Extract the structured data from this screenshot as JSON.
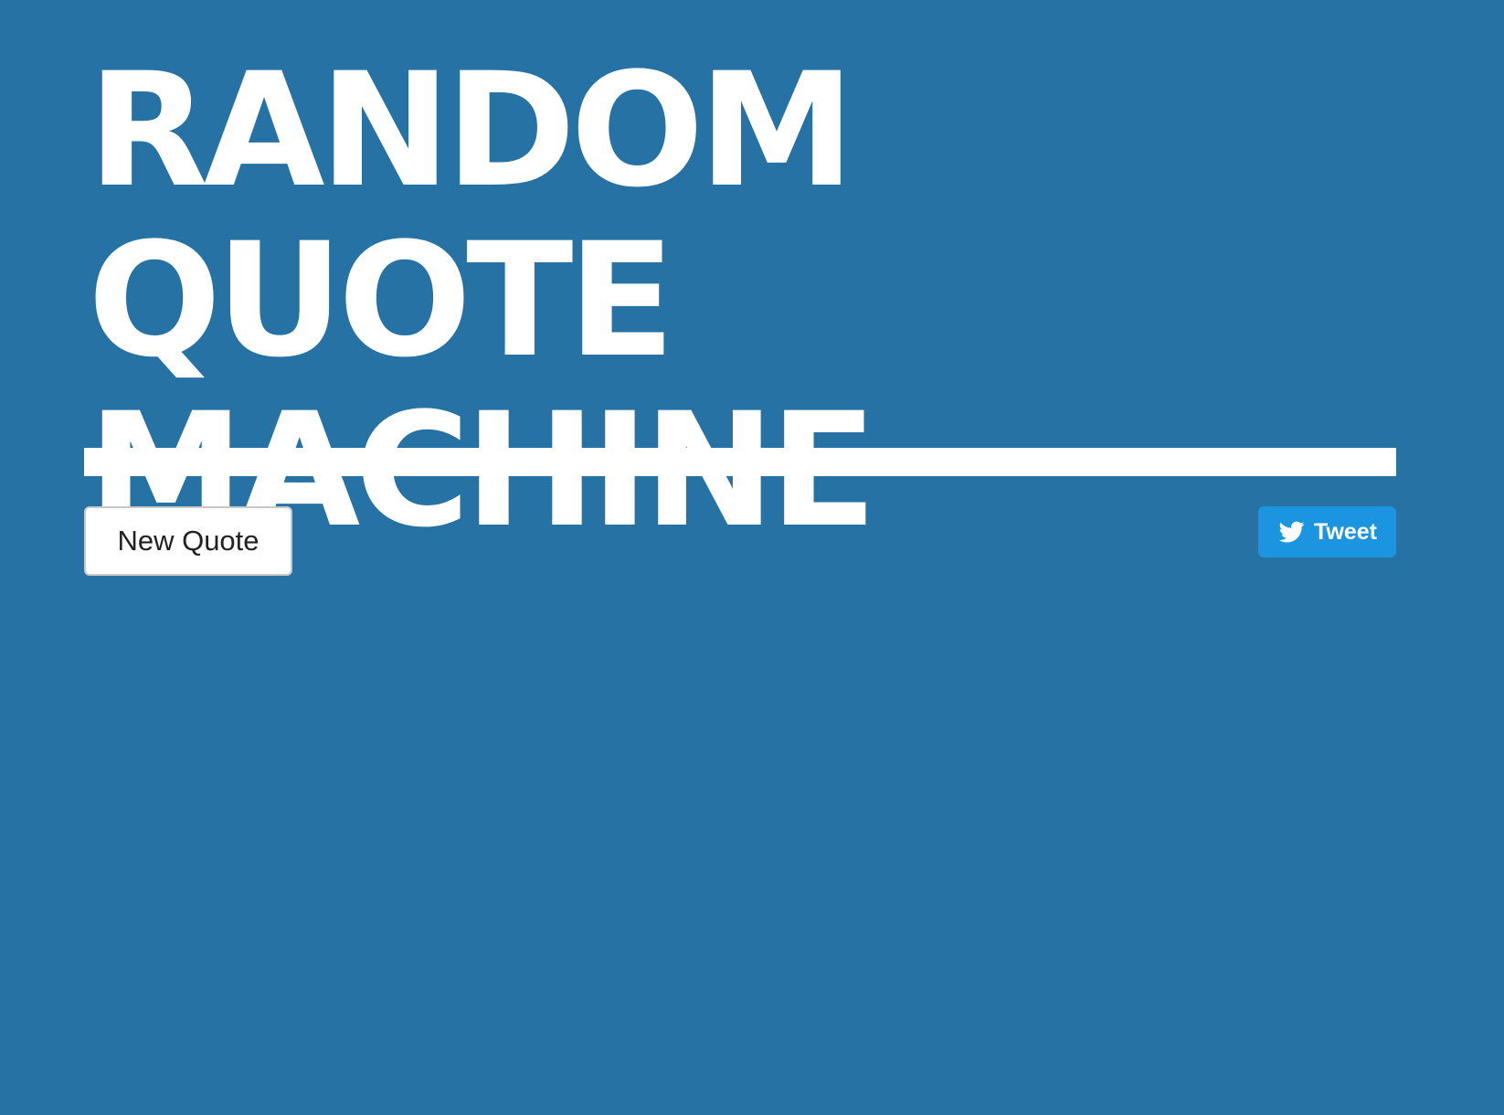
{
  "header": {
    "title": "RANDOM QUOTE MACHINE"
  },
  "quote": {
    "text": ""
  },
  "actions": {
    "new_quote_label": "New Quote",
    "tweet_label": "Tweet",
    "tweet_icon": "twitter-bird-icon"
  },
  "colors": {
    "background": "#2672a4",
    "tweet_button": "#1b95e0",
    "title": "#ffffff"
  }
}
